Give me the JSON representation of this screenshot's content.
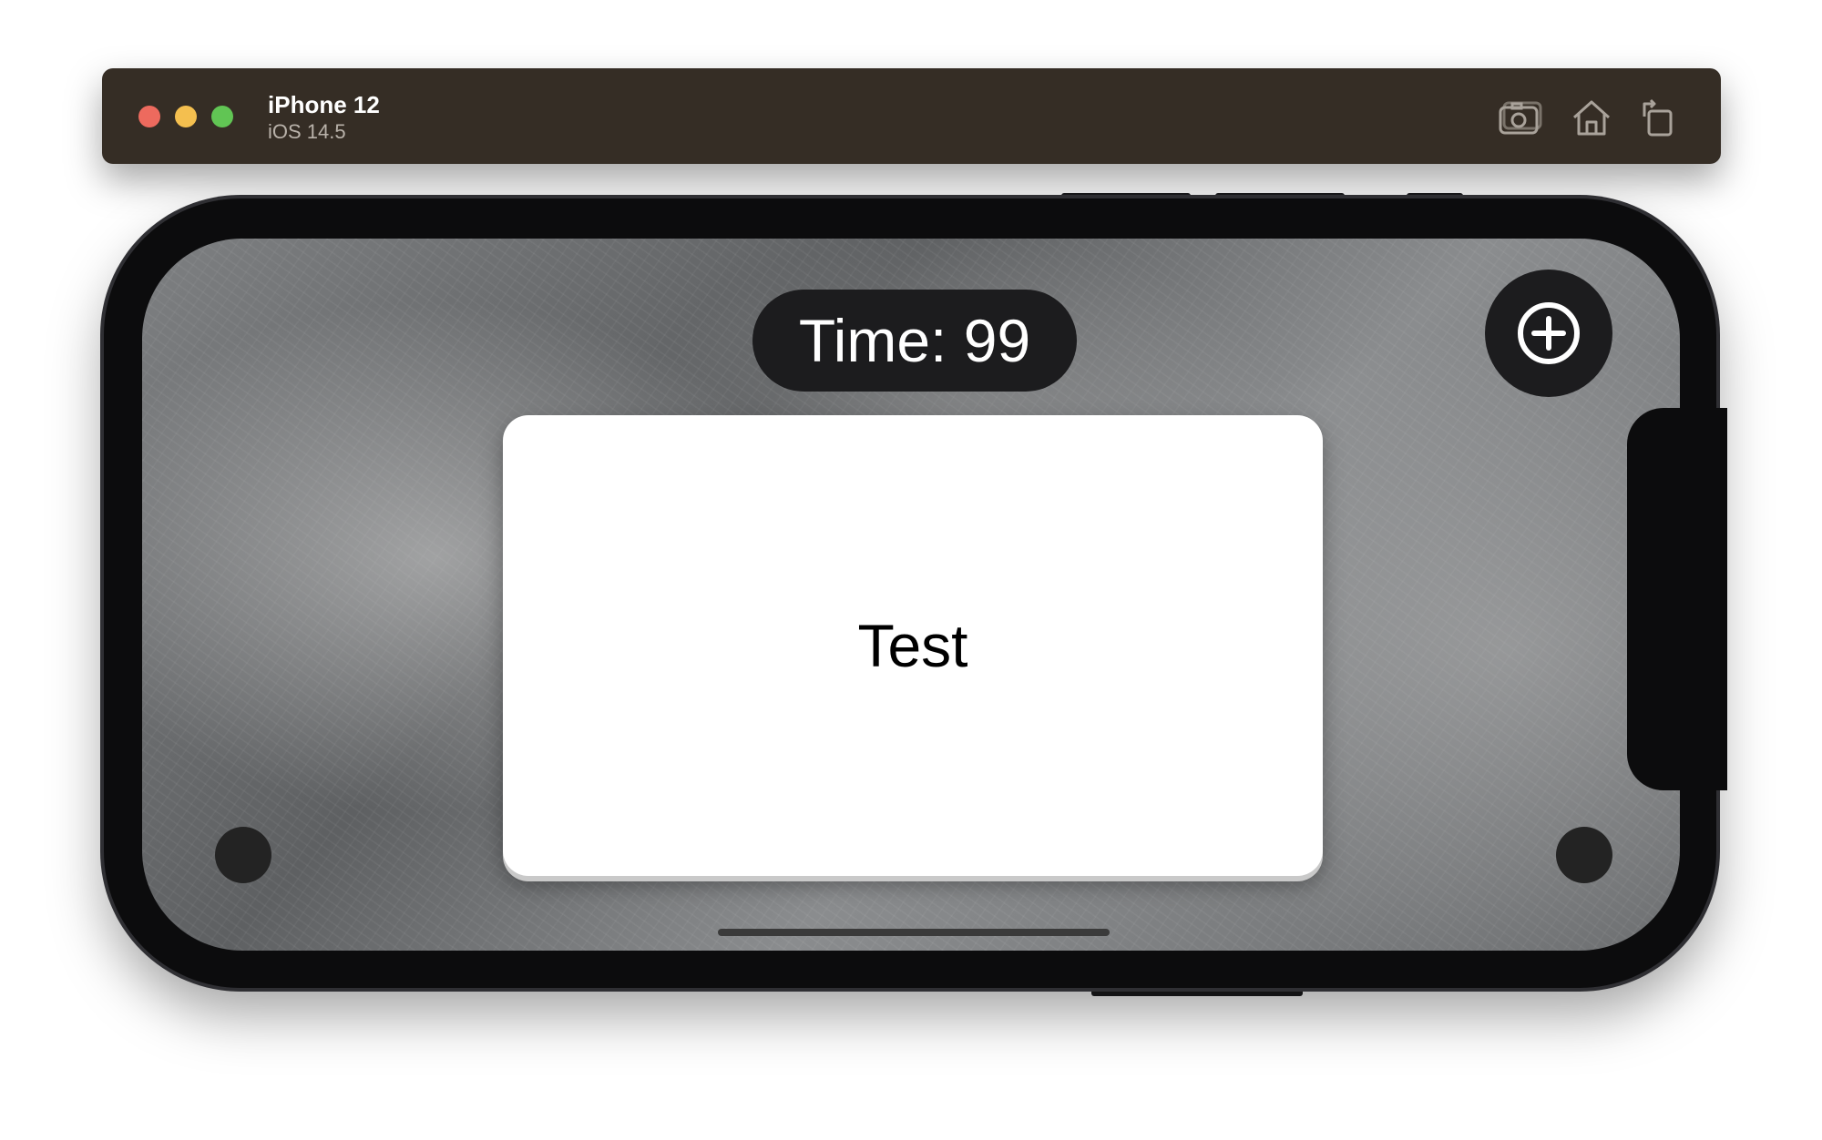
{
  "window": {
    "title": "iPhone 12",
    "subtitle": "iOS 14.5",
    "controls": [
      "close-button",
      "minimize-button",
      "zoom-button"
    ],
    "toolbar_icons": [
      "screenshot-icon",
      "home-icon",
      "rotate-icon"
    ]
  },
  "app": {
    "timer_text": "Time: 99",
    "card_text": "Test",
    "add_button_icon": "plus-circle-icon"
  },
  "colors": {
    "titlebar": "#352d25",
    "close": "#ed6a5e",
    "minimize": "#f4bf4f",
    "zoom": "#61c554",
    "pill": "#1c1c1e",
    "card": "#ffffff"
  }
}
